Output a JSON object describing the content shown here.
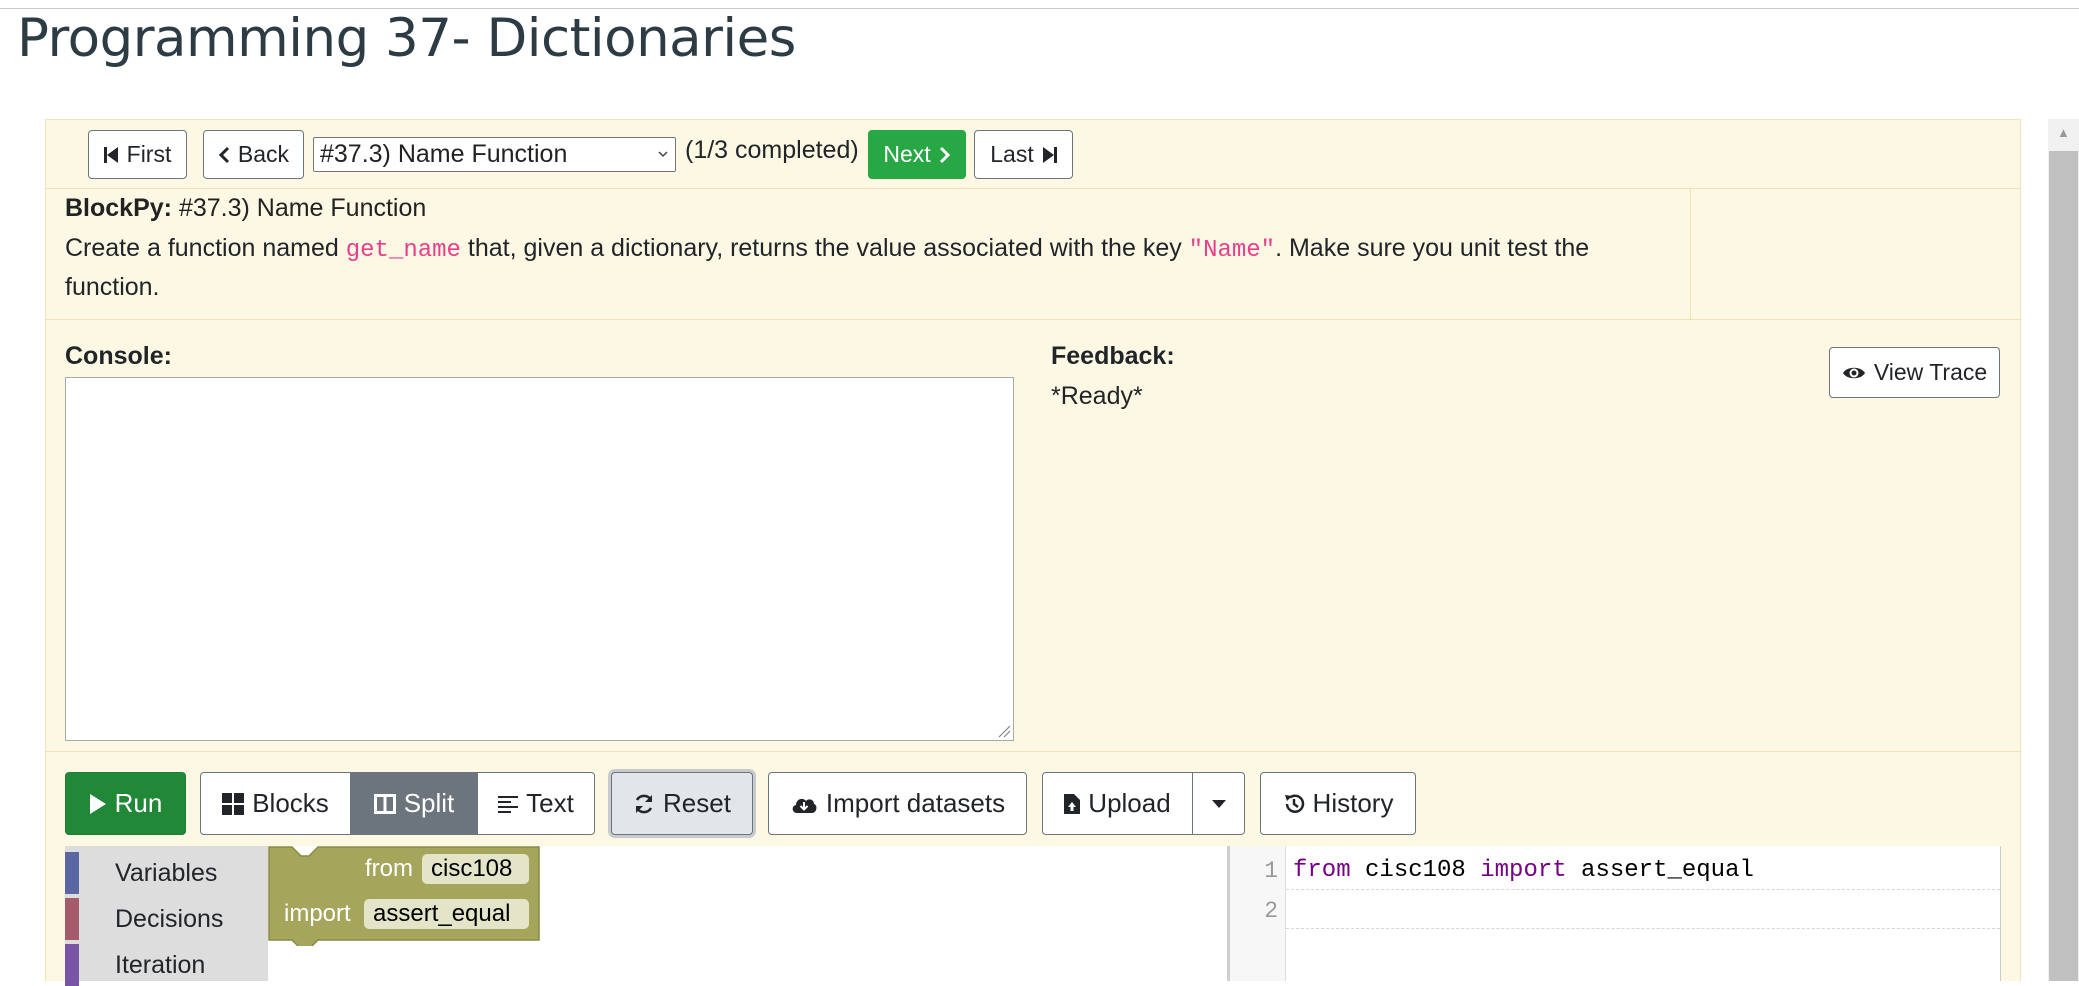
{
  "page": {
    "title": "Programming 37- Dictionaries"
  },
  "nav": {
    "first": "First",
    "back": "Back",
    "assignment_select": "#37.3) Name Function",
    "completed": "(1/3 completed)",
    "next": "Next",
    "last": "Last"
  },
  "instructions": {
    "heading_label": "BlockPy:",
    "heading_title": "#37.3) Name Function",
    "text_1": "Create a function named ",
    "code_1": "get_name",
    "text_2": " that, given a dictionary, returns the value associated with the key ",
    "code_2": "\"Name\"",
    "text_3": ". Make sure you unit test the function."
  },
  "console": {
    "label": "Console:"
  },
  "feedback": {
    "label": "Feedback:",
    "status": "*Ready*",
    "view_trace": "View Trace"
  },
  "toolbar": {
    "run": "Run",
    "blocks": "Blocks",
    "split": "Split",
    "text": "Text",
    "reset": "Reset",
    "import_datasets": "Import datasets",
    "upload": "Upload",
    "history": "History"
  },
  "toolbox": {
    "categories": [
      {
        "label": "Variables",
        "color": "#5b67a5"
      },
      {
        "label": "Decisions",
        "color": "#a55b6b"
      },
      {
        "label": "Iteration",
        "color": "#7b55a5"
      }
    ]
  },
  "block": {
    "from_label": "from",
    "module": "cisc108",
    "import_label": "import",
    "name": "assert_equal",
    "color": "#a5a55b"
  },
  "editor": {
    "line_numbers": [
      "1",
      "2"
    ],
    "line1": {
      "kw_from": "from",
      "module": " cisc108 ",
      "kw_import": "import",
      "name": " assert_equal"
    }
  },
  "colors": {
    "accent_green": "#28a745",
    "panel_background": "#fcf8e3",
    "code_pink": "#e83e8c",
    "keyword_purple": "#770088"
  }
}
